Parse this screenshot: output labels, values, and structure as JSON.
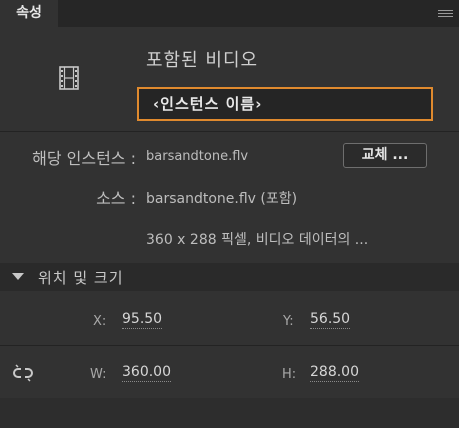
{
  "panel": {
    "tab_label": "속성"
  },
  "symbol": {
    "type": "포함된 비디오"
  },
  "instance_name": {
    "placeholder": "‹인스턴스 이름›"
  },
  "instance": {
    "label": "해당 인스턴스 :",
    "value": "barsandtone.flv",
    "swap_button": "교체 ..."
  },
  "source": {
    "label": "소스 :",
    "value": "barsandtone.flv (포함)",
    "info": "360 x 288 픽셀, 비디오 데이터의 ..."
  },
  "position_size": {
    "title": "위치 및 크기",
    "x_label": "X:",
    "x_value": "95.50",
    "y_label": "Y:",
    "y_value": "56.50",
    "w_label": "W:",
    "w_value": "360.00",
    "h_label": "H:",
    "h_value": "288.00"
  },
  "colors": {
    "accent": "#e08a2e",
    "panel_bg": "#323232"
  }
}
